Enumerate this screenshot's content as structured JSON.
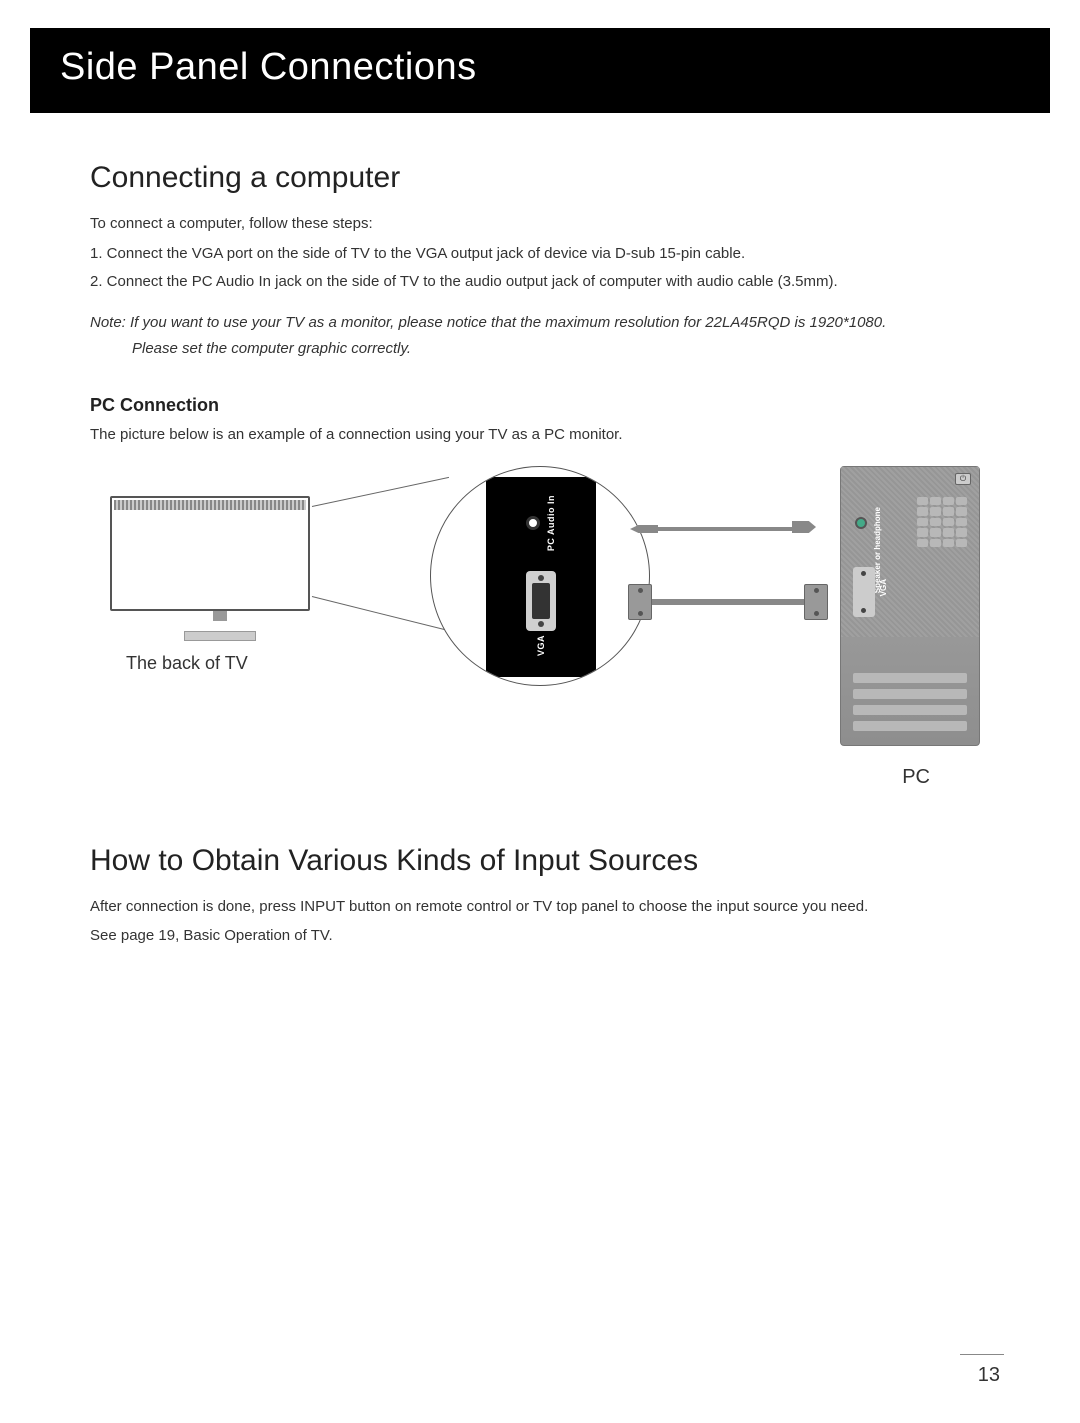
{
  "header": {
    "title": "Side Panel Connections"
  },
  "section1": {
    "title": "Connecting a computer",
    "intro": "To  connect a computer, follow these steps:",
    "step1": "1. Connect the VGA port on the side of TV to the VGA output jack of device via D-sub 15-pin cable.",
    "step2": "2. Connect the PC Audio In jack on the side of TV to the audio output jack of computer with audio cable (3.5mm).",
    "note_line1": "Note: If you want to use your TV as a monitor, please notice that the maximum resolution for 22LA45RQD is 1920*1080.",
    "note_line2": "Please set the computer graphic correctly."
  },
  "subsection": {
    "title": "PC Connection",
    "desc": "The picture below is an example of a connection using your TV as a PC monitor."
  },
  "diagram": {
    "tv_caption": "The back of TV",
    "pc_caption": "PC",
    "pc_audio_label": "PC Audio In",
    "vga_label": "VGA",
    "speaker_label": "Speaker or headphone"
  },
  "section2": {
    "title": "How to Obtain Various Kinds of Input Sources",
    "p1": "After connection is done, press INPUT button on remote control or TV top panel to choose the input source you need.",
    "p2": "See page 19, Basic Operation of TV."
  },
  "page_number": "13"
}
